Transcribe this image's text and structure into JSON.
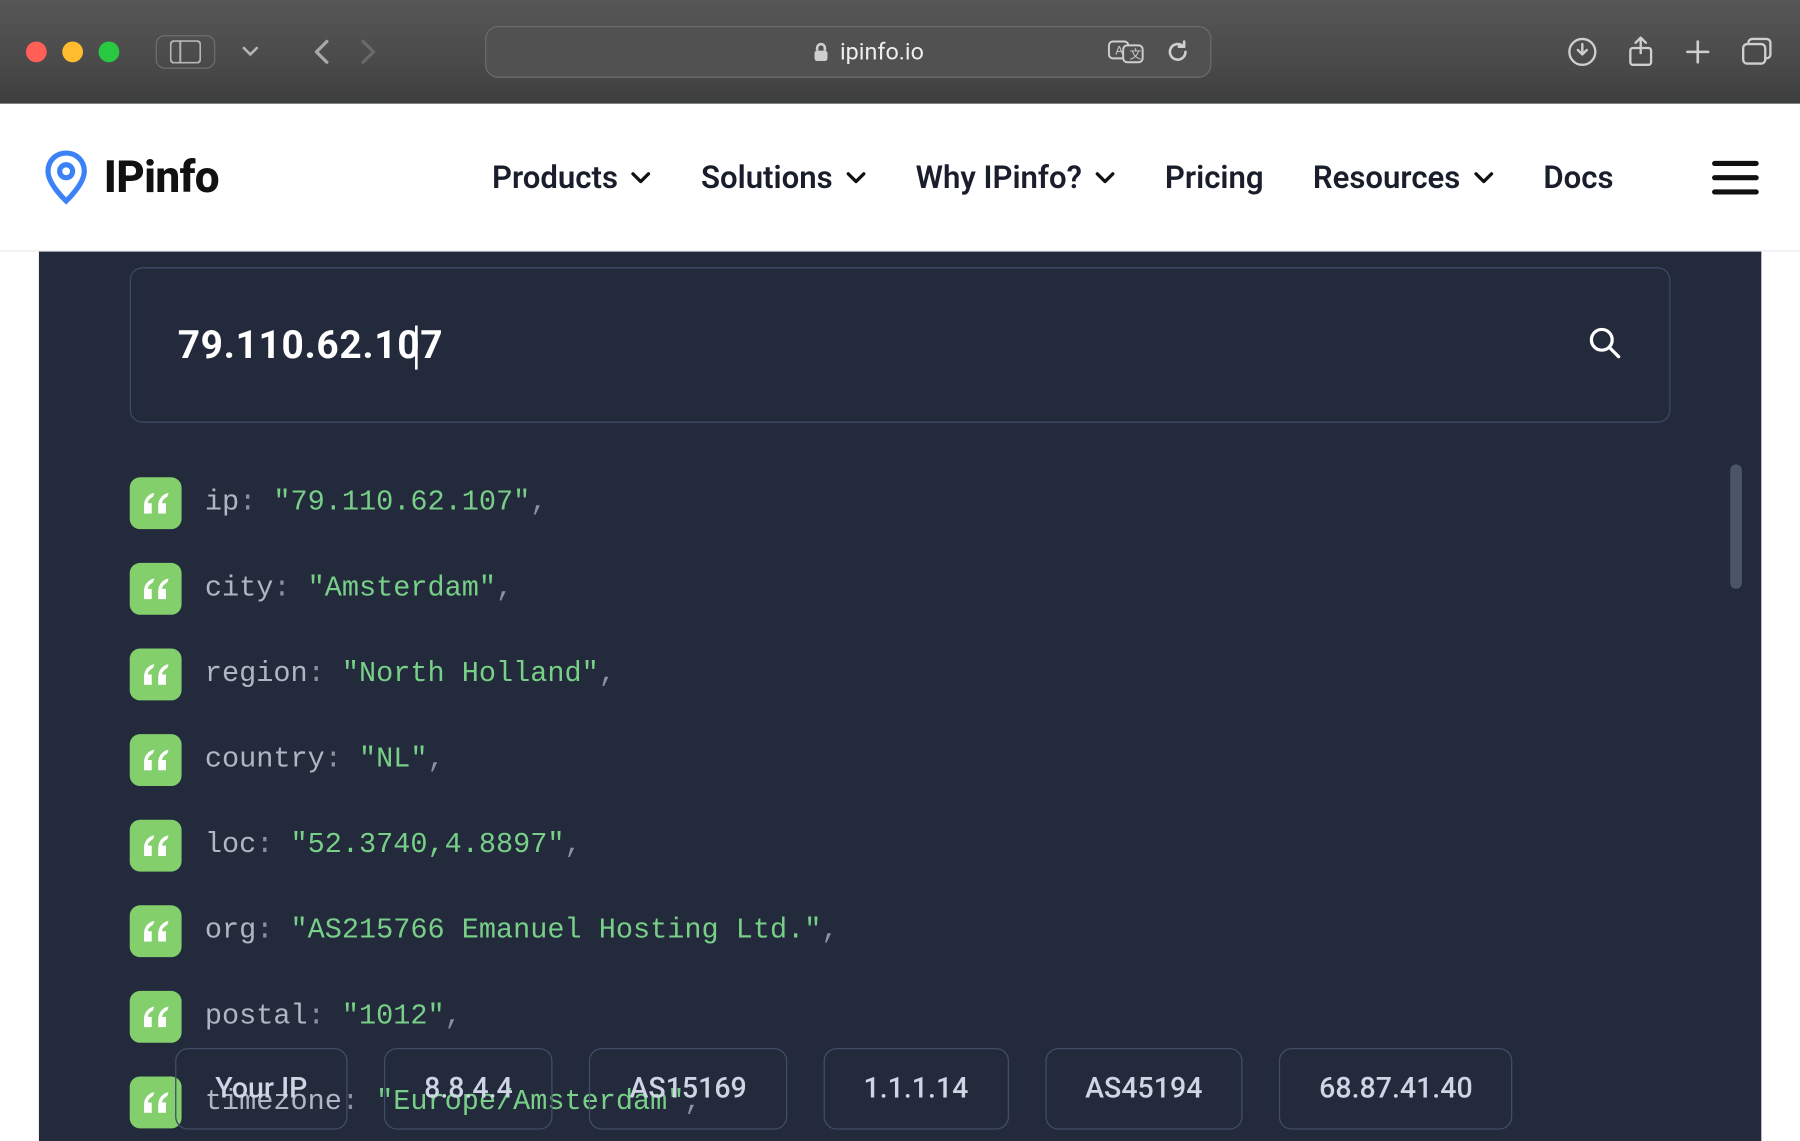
{
  "browser": {
    "host": "ipinfo.io"
  },
  "header": {
    "brand": "IPinfo",
    "nav": {
      "products": "Products",
      "solutions": "Solutions",
      "why": "Why IPinfo?",
      "pricing": "Pricing",
      "resources": "Resources",
      "docs": "Docs"
    }
  },
  "search": {
    "value": "79.110.62.107"
  },
  "result": {
    "ip": {
      "key": "ip",
      "value": "\"79.110.62.107\""
    },
    "city": {
      "key": "city",
      "value": "\"Amsterdam\""
    },
    "region": {
      "key": "region",
      "value": "\"North Holland\""
    },
    "country": {
      "key": "country",
      "value": "\"NL\""
    },
    "loc": {
      "key": "loc",
      "value": "\"52.3740,4.8897\""
    },
    "org": {
      "key": "org",
      "value": "\"AS215766 Emanuel Hosting Ltd.\""
    },
    "postal": {
      "key": "postal",
      "value": "\"1012\""
    },
    "timezone": {
      "key": "timezone",
      "value": "\"Europe/Amsterdam\""
    }
  },
  "chips": {
    "yourip": "Your IP",
    "c1": "8.8.4.4",
    "c2": "AS15169",
    "c3": "1.1.1.14",
    "c4": "AS45194",
    "c5": "68.87.41.40"
  }
}
